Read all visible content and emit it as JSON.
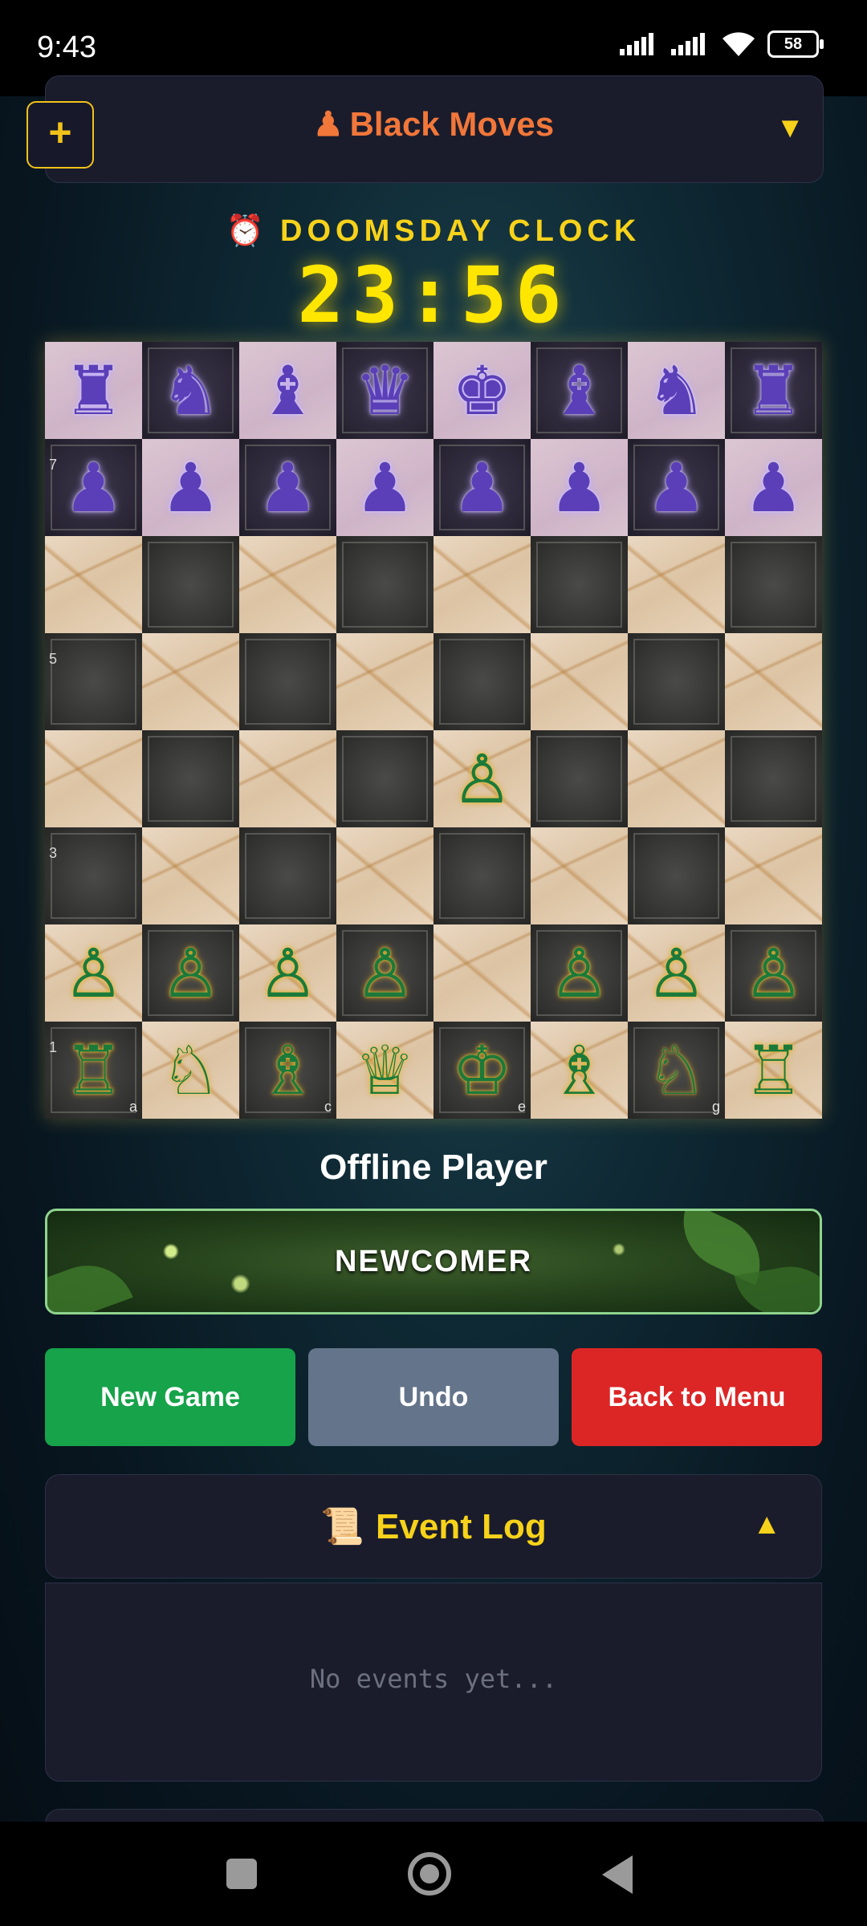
{
  "status_bar": {
    "time": "9:43",
    "battery": "58"
  },
  "header": {
    "add_label": "+",
    "turn_icon": "♟",
    "turn_text": "Black Moves",
    "dropdown_icon": "▼"
  },
  "clock": {
    "icon": "⏰",
    "title": "DOOMSDAY CLOCK",
    "value": "23:56"
  },
  "board": {
    "rows": [
      [
        "♜",
        "♞",
        "♝",
        "♛",
        "♚",
        "♝",
        "♞",
        "♜"
      ],
      [
        "♟",
        "♟",
        "♟",
        "♟",
        "♟",
        "♟",
        "♟",
        "♟"
      ],
      [
        "",
        "",
        "",
        "",
        "",
        "",
        "",
        ""
      ],
      [
        "",
        "",
        "",
        "",
        "",
        "",
        "",
        ""
      ],
      [
        "",
        "",
        "",
        "",
        "♙",
        "",
        "",
        ""
      ],
      [
        "",
        "",
        "",
        "",
        "",
        "",
        "",
        ""
      ],
      [
        "♙",
        "♙",
        "♙",
        "♙",
        "",
        "♙",
        "♙",
        "♙"
      ],
      [
        "♖",
        "♘",
        "♗",
        "♕",
        "♔",
        "♗",
        "♘",
        "♖"
      ]
    ],
    "colors": [
      [
        "b",
        "b",
        "b",
        "b",
        "b",
        "b",
        "b",
        "b"
      ],
      [
        "b",
        "b",
        "b",
        "b",
        "b",
        "b",
        "b",
        "b"
      ],
      [
        "",
        "",
        "",
        "",
        "",
        "",
        "",
        ""
      ],
      [
        "",
        "",
        "",
        "",
        "",
        "",
        "",
        ""
      ],
      [
        "",
        "",
        "",
        "",
        "w",
        "",
        "",
        ""
      ],
      [
        "",
        "",
        "",
        "",
        "",
        "",
        "",
        ""
      ],
      [
        "w",
        "w",
        "w",
        "w",
        "",
        "w",
        "w",
        "w"
      ],
      [
        "w",
        "w",
        "w",
        "w",
        "w",
        "w",
        "w",
        "w"
      ]
    ],
    "rank_labels": [
      "",
      "7",
      "",
      "5",
      "",
      "3",
      "",
      "1"
    ],
    "file_labels": [
      "a",
      "",
      "c",
      "",
      "e",
      "",
      "g",
      ""
    ]
  },
  "player": {
    "name": "Offline Player",
    "rank": "NEWCOMER"
  },
  "buttons": {
    "new_game": "New Game",
    "undo": "Undo",
    "back_to_menu": "Back to Menu"
  },
  "event_log": {
    "icon": "📜",
    "title": "Event Log",
    "toggle_icon": "▲",
    "empty_text": "No events yet..."
  }
}
